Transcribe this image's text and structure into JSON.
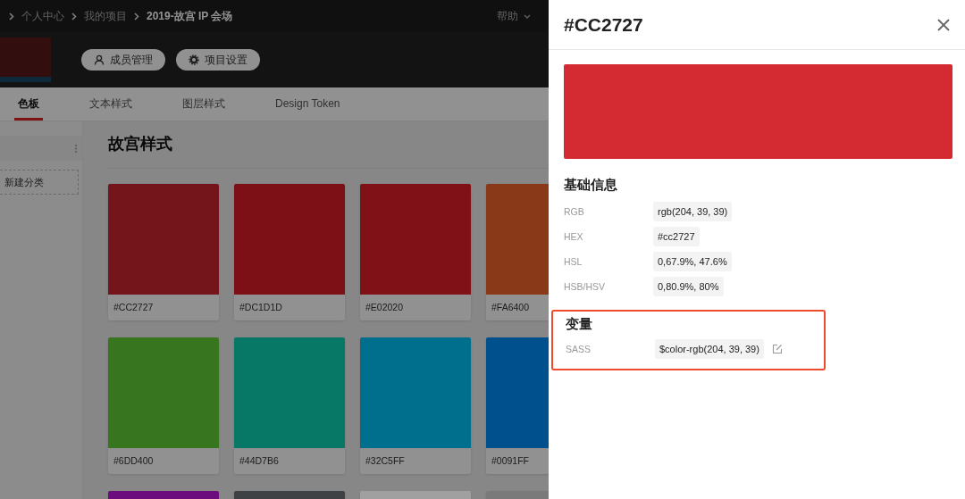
{
  "breadcrumb": [
    {
      "label": "个人中心",
      "current": false
    },
    {
      "label": "我的项目",
      "current": false
    },
    {
      "label": "2019-故宫 IP 会场",
      "current": true
    }
  ],
  "help": "帮助",
  "project_buttons": [
    {
      "kind": "members",
      "label": "成员管理"
    },
    {
      "kind": "settings",
      "label": "项目设置"
    }
  ],
  "tabs": [
    {
      "label": "色板",
      "selected": true
    },
    {
      "label": "文本样式",
      "selected": false
    },
    {
      "label": "图层样式",
      "selected": false
    },
    {
      "label": "Design Token",
      "selected": false
    }
  ],
  "sidebar": {
    "new_category": "新建分类"
  },
  "palette": {
    "title": "故宫样式",
    "swatches": [
      {
        "label": "#CC2727",
        "color": "#74151c"
      },
      {
        "label": "#DC1D1D",
        "color": "#7d1016"
      },
      {
        "label": "#E02020",
        "color": "#801117"
      },
      {
        "label": "#FA6400",
        "color": "#8a3918"
      },
      {
        "label": "#6DD400",
        "color": "#37761e"
      },
      {
        "label": "#44D7B6",
        "color": "#067865"
      },
      {
        "label": "#32C5FF",
        "color": "#006f8e"
      },
      {
        "label": "#0091FF",
        "color": "#00508d"
      },
      {
        "color": "#6b0d7c"
      },
      {
        "color": "#3f4245"
      },
      {
        "color": "#a0a0a0"
      },
      {
        "color": "#7a7a7a"
      }
    ]
  },
  "detail": {
    "title": "#CC2727",
    "color": "#d42a31",
    "basic_heading": "基础信息",
    "basic": [
      {
        "label": "RGB",
        "value": "rgb(204, 39, 39)"
      },
      {
        "label": "HEX",
        "value": "#cc2727"
      },
      {
        "label": "HSL",
        "value": "0,67.9%, 47.6%"
      },
      {
        "label": "HSB/HSV",
        "value": "0,80.9%, 80%"
      }
    ],
    "variables_heading": "变量",
    "variables_highlighted": true,
    "variables": [
      {
        "label": "SASS",
        "value": "$color-rgb(204, 39, 39)",
        "editable": true
      }
    ]
  }
}
